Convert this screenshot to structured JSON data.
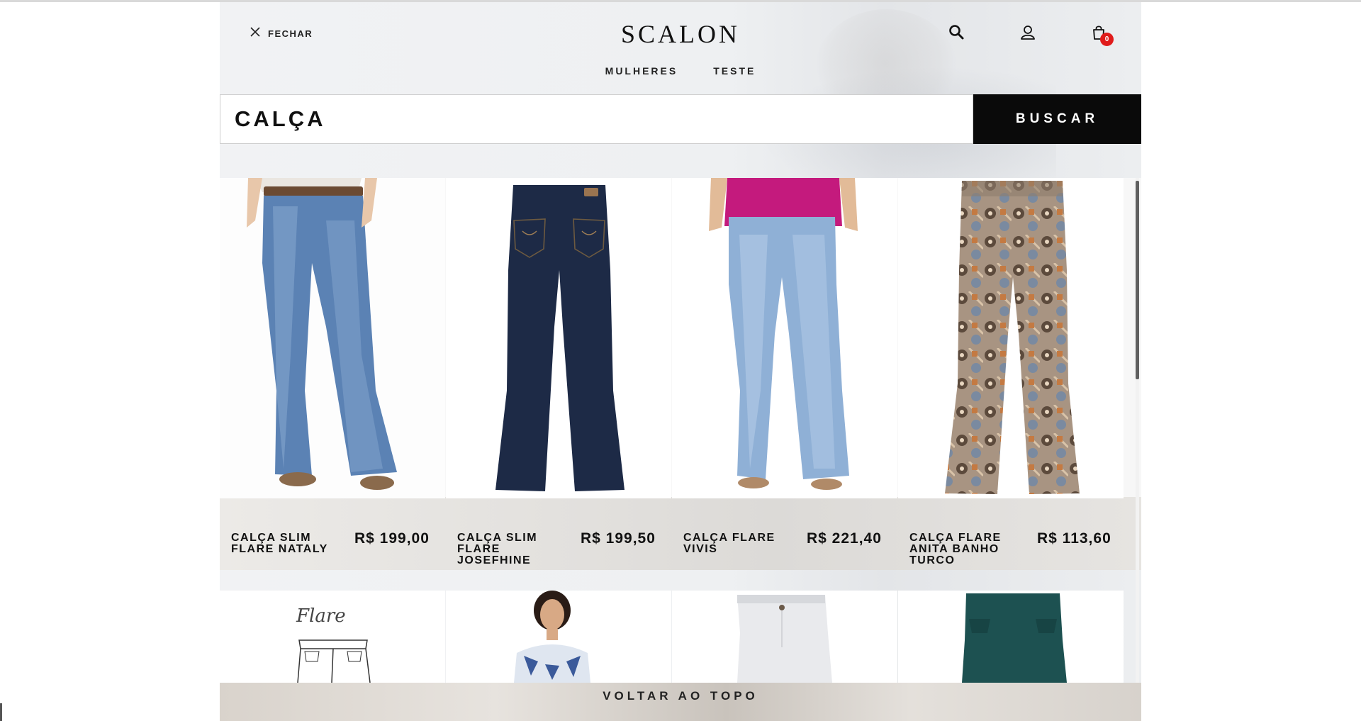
{
  "header": {
    "close_label": "FECHAR",
    "logo": "SCALON",
    "cart_count": "0",
    "nav": [
      "MULHERES",
      "TESTE"
    ]
  },
  "search": {
    "value": "CALÇA",
    "button_label": "BUSCAR"
  },
  "products": [
    {
      "name": "CALÇA SLIM FLARE NATALY",
      "price": "R$ 199,00",
      "image": "light-blue-flare-jeans"
    },
    {
      "name": "CALÇA SLIM FLARE JOSEFHINE",
      "price": "R$ 199,50",
      "image": "dark-denim-flare-jeans"
    },
    {
      "name": "CALÇA FLARE VIVIS",
      "price": "R$ 221,40",
      "image": "light-blue-flare-jeans-pink-top"
    },
    {
      "name": "CALÇA FLARE ANITA BANHO TURCO",
      "price": "R$ 113,60",
      "image": "printed-flare-pants"
    }
  ],
  "row2_images": [
    {
      "image": "flare-sketch",
      "caption": "Flare"
    },
    {
      "image": "model-printed-top"
    },
    {
      "image": "white-pants"
    },
    {
      "image": "teal-pants"
    }
  ],
  "footer": {
    "back_to_top": "VOLTAR AO TOPO"
  },
  "colors": {
    "badge": "#e01b1b",
    "button": "#0a0a0a"
  }
}
